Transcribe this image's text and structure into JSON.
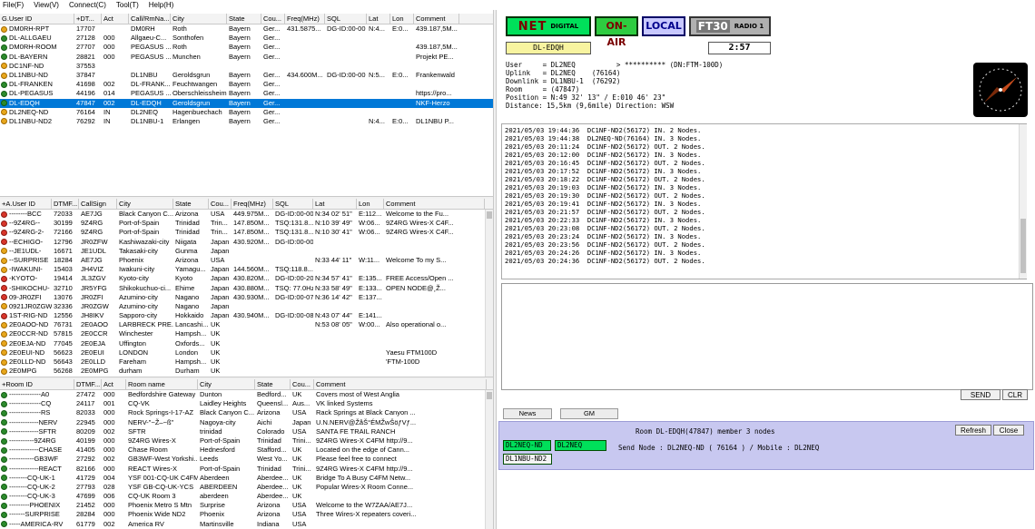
{
  "menu": [
    "File(F)",
    "View(V)",
    "Connect(C)",
    "Tool(T)",
    "Help(H)"
  ],
  "colors": {
    "selected_row": "#0078d7",
    "net_green": "#00e05a",
    "onair_green": "#2ecc40",
    "local_blue": "#c8c8ff",
    "radio_gray": "#b0b0b0",
    "room_panel": "#c8c8f0"
  },
  "top_grid": {
    "headers": [
      "G.User ID",
      "+DT...",
      "Act",
      "Call/RmNa...",
      "City",
      "State",
      "Cou...",
      "Freq(MHz)",
      "SQL",
      "Lat",
      "Lon",
      "Comment"
    ],
    "rows": [
      {
        "icon": "node",
        "c": [
          "DM0RH-RPT",
          "17707",
          "",
          "DM0RH",
          "Roth",
          "Bayern",
          "Ger...",
          "431.5875...",
          "DG-ID:00-00",
          "N:4...",
          "E:0...",
          "439.187,5M..."
        ]
      },
      {
        "icon": "room",
        "c": [
          "DL-ALLGAEU",
          "27128",
          "000",
          "Allgaeu-C...",
          "Sonthofen",
          "Bayern",
          "Ger...",
          "",
          "",
          "",
          "",
          ""
        ]
      },
      {
        "icon": "room",
        "c": [
          "DM0RH-ROOM",
          "27707",
          "000",
          "PEGASUS ...",
          "Roth",
          "Bayern",
          "Ger...",
          "",
          "",
          "",
          "",
          "439.187,5M..."
        ]
      },
      {
        "icon": "room",
        "c": [
          "DL-BAYERN",
          "28821",
          "000",
          "PEGASUS ...",
          "Munchen",
          "Bayern",
          "Ger...",
          "",
          "",
          "",
          "",
          "Projekt PE..."
        ]
      },
      {
        "icon": "node",
        "c": [
          "DC1NF-ND",
          "37553",
          "",
          "",
          "",
          "",
          "",
          "",
          "",
          "",
          "",
          ""
        ]
      },
      {
        "icon": "node",
        "c": [
          "DL1NBU-ND",
          "37847",
          "",
          "DL1NBU",
          "Geroldsgrun",
          "Bayern",
          "Ger...",
          "434.600M...",
          "DG-ID:00-00",
          "N:5...",
          "E:0...",
          "Frankenwald"
        ]
      },
      {
        "icon": "room",
        "c": [
          "DL-FRANKEN",
          "41698",
          "002",
          "DL-FRANK...",
          "Feuchtwangen",
          "Bayern",
          "Ger...",
          "",
          "",
          "",
          "",
          ""
        ]
      },
      {
        "icon": "room",
        "c": [
          "DL-PEGASUS",
          "44196",
          "014",
          "PEGASUS ...",
          "Oberschleissheim",
          "Bayern",
          "Ger...",
          "",
          "",
          "",
          "",
          "https://pro..."
        ]
      },
      {
        "icon": "room",
        "sel": true,
        "c": [
          "DL-EDQH",
          "47847",
          "002",
          "DL-EDQH",
          "Geroldsgrun",
          "Bayern",
          "Ger...",
          "",
          "",
          "",
          "",
          "NKF-Herzo"
        ]
      },
      {
        "icon": "node",
        "c": [
          "DL2NEQ-ND",
          "76164",
          "IN",
          "DL2NEQ",
          "Hagenbuechach",
          "Bayern",
          "Ger...",
          "",
          "",
          "",
          "",
          ""
        ]
      },
      {
        "icon": "node",
        "c": [
          "DL1NBU-ND2",
          "76292",
          "IN",
          "DL1NBU-1",
          "Erlangen",
          "Bayern",
          "Ger...",
          "",
          "",
          "N:4...",
          "E:0...",
          "DL1NBU P..."
        ]
      }
    ]
  },
  "mid_grid": {
    "headers": [
      "+A.User ID",
      "DTMF...",
      "CallSign",
      "City",
      "State",
      "Cou...",
      "Freq(MHz)",
      "SQL",
      "Lat",
      "Lon",
      "Comment"
    ],
    "rows": [
      {
        "icon": "usr",
        "c": [
          "--------BCC",
          "72033",
          "AE7JG",
          "Black Canyon C...",
          "Arizona",
          "USA",
          "449.975M...",
          "DG-ID:00-00",
          "N:34 02' 51\"",
          "E:112...",
          "Welcome to the Fu..."
        ]
      },
      {
        "icon": "usr",
        "c": [
          "--9Z4RG--",
          "30199",
          "9Z4RG",
          "Port-of-Spain",
          "Trinidad",
          "Trin...",
          "147.850M...",
          "TSQ:131.8...",
          "N:10 39' 49\"",
          "W:06...",
          "9Z4RG Wires-X C4F..."
        ]
      },
      {
        "icon": "usr",
        "c": [
          "--9Z4RG-2-",
          "72166",
          "9Z4RG",
          "Port-of-Spain",
          "Trinidad",
          "Trin...",
          "147.850M...",
          "TSQ:131.8...",
          "N:10 30' 41\"",
          "W:06...",
          "9Z4RG Wires-X C4F..."
        ]
      },
      {
        "icon": "usr",
        "c": [
          "--ECHIGO-",
          "12796",
          "JR0ZFW",
          "Kashiwazaki-city",
          "Niigata",
          "Japan",
          "430.920M...",
          "DG-ID:00-00",
          "",
          "",
          ""
        ]
      },
      {
        "icon": "node",
        "c": [
          "--JE1UDL-",
          "16671",
          "JE1UDL",
          "Takasaki-city",
          "Gunma",
          "Japan",
          "",
          "",
          "",
          "",
          ""
        ]
      },
      {
        "icon": "node",
        "c": [
          "--SURPRISE",
          "18284",
          "AE7JG",
          "Phoenix",
          "Arizona",
          "USA",
          "",
          "",
          "N:33 44' 11\"",
          "W:11...",
          "Welcome To my S..."
        ]
      },
      {
        "icon": "node",
        "c": [
          "-IWAKUNI-",
          "15403",
          "JH4VIZ",
          "Iwakuni-city",
          "Yamagu...",
          "Japan",
          "144.560M...",
          "TSQ:118.8...",
          "",
          "",
          ""
        ]
      },
      {
        "icon": "usr",
        "c": [
          "-KYOTO-",
          "19414",
          "JL3ZGV",
          "Kyoto-city",
          "Kyoto",
          "Japan",
          "430.820M...",
          "DG-ID:00-20",
          "N:34 57' 41\"",
          "E:135...",
          "FREE Access/Open ..."
        ]
      },
      {
        "icon": "usr",
        "c": [
          "-SHIKOCHU-",
          "32710",
          "JR5YFG",
          "Shikokuchuo-ci...",
          "Ehime",
          "Japan",
          "430.880M...",
          "TSQ: 77.0Hz",
          "N:33 58' 49\"",
          "E:133...",
          "OPEN NODE@¸Ž..."
        ]
      },
      {
        "icon": "usr",
        "c": [
          "09-JR0ZFI",
          "13076",
          "JR0ZFI",
          "Azumino-city",
          "Nagano",
          "Japan",
          "430.930M...",
          "DG-ID:00-07",
          "N:36 14' 42\"",
          "E:137...",
          ""
        ]
      },
      {
        "icon": "node",
        "c": [
          "0921JR0ZGW",
          "32336",
          "JR0ZGW",
          "Azumino-city",
          "Nagano",
          "Japan",
          "",
          "",
          "",
          "",
          ""
        ]
      },
      {
        "icon": "usr",
        "c": [
          "1ST-RIG-ND",
          "12556",
          "JH8IKV",
          "Sapporo-city",
          "Hokkaido",
          "Japan",
          "430.940M...",
          "DG-ID:00-08",
          "N:43 07' 44\"",
          "E:141...",
          ""
        ]
      },
      {
        "icon": "node",
        "c": [
          "2E0AOO-ND",
          "76731",
          "2E0AOO",
          "LARBRECK PRE...",
          "Lancashi...",
          "UK",
          "",
          "",
          "N:53 08' 05\"",
          "W:00...",
          "Also operational o..."
        ]
      },
      {
        "icon": "node",
        "c": [
          "2E0CCR-ND",
          "57815",
          "2E0CCR",
          "Winchester",
          "Hampsh...",
          "UK",
          "",
          "",
          "",
          "",
          ""
        ]
      },
      {
        "icon": "node",
        "c": [
          "2E0EJA-ND",
          "77045",
          "2E0EJA",
          "Uffington",
          "Oxfords...",
          "UK",
          "",
          "",
          "",
          "",
          ""
        ]
      },
      {
        "icon": "node",
        "c": [
          "2E0EUI-ND",
          "56623",
          "2E0EUI",
          "LONDON",
          "London",
          "UK",
          "",
          "",
          "",
          "",
          "Yaesu FTM100D"
        ]
      },
      {
        "icon": "node",
        "c": [
          "2E0LLD-ND",
          "56643",
          "2E0LLD",
          "Fareham",
          "Hampsh...",
          "UK",
          "",
          "",
          "",
          "",
          "'FTM-100D"
        ]
      },
      {
        "icon": "node",
        "c": [
          "2E0MPG",
          "56268",
          "2E0MPG",
          "durham",
          "Durham",
          "UK",
          "",
          "",
          "",
          "",
          ""
        ]
      }
    ]
  },
  "bot_grid": {
    "headers": [
      "+Room ID",
      "DTMF...",
      "Act",
      "Room name",
      "City",
      "State",
      "Cou...",
      "Comment"
    ],
    "rows": [
      {
        "icon": "room",
        "c": [
          "--------------A0",
          "27472",
          "000",
          "Bedfordshire Gateway",
          "Dunton",
          "Bedford...",
          "UK",
          "Covers most of West Anglia"
        ]
      },
      {
        "icon": "room",
        "c": [
          "--------------CQ",
          "24117",
          "001",
          "CQ-VK",
          "Laidley Heights",
          "Queensl...",
          "Aus...",
          "VK linked Systems"
        ]
      },
      {
        "icon": "room",
        "c": [
          "--------------RS",
          "82033",
          "000",
          "Rock Springs-I-17-AZ",
          "Black Canyon C...",
          "Arizona",
          "USA",
          "Rack Springs at Black Canyon ..."
        ]
      },
      {
        "icon": "room",
        "c": [
          "-------------NERV",
          "22945",
          "000",
          "NERV-\"~Ž–~ß\"",
          "Nagoya-city",
          "Aichi",
          "Japan",
          "U.N.NERV@ŽåŠ°ÉMŽwŠöƒVƒ..."
        ]
      },
      {
        "icon": "room",
        "c": [
          "-------------SFTR",
          "80209",
          "002",
          "SFTR",
          "trinidad",
          "Colorado",
          "USA",
          "SANTA FE TRAIL RANCH"
        ]
      },
      {
        "icon": "room",
        "c": [
          "-----------9Z4RG",
          "40199",
          "000",
          "9Z4RG Wires-X",
          "Port-of-Spain",
          "Trinidad",
          "Trini...",
          "9Z4RG Wires-X C4FM http://9..."
        ]
      },
      {
        "icon": "room",
        "c": [
          "-------------CHASE",
          "41405",
          "000",
          "Chase Room",
          "Hednesford",
          "Stafford...",
          "UK",
          "Located on the edge of Cann..."
        ]
      },
      {
        "icon": "room",
        "c": [
          "-----------GB3WF",
          "27292",
          "002",
          "GB3WF-West Yorkshi...",
          "Leeds",
          "West Yo...",
          "UK",
          "Please feel free to connect"
        ]
      },
      {
        "icon": "room",
        "c": [
          "-------------REACT",
          "82166",
          "000",
          "REACT Wires-X",
          "Port-of-Spain",
          "Trinidad",
          "Trini...",
          "9Z4RG Wires-X C4FM http://9..."
        ]
      },
      {
        "icon": "room",
        "c": [
          "--------CQ-UK-1",
          "41729",
          "004",
          "YSF 001-CQ-UK C4FM",
          "Aberdeen",
          "Aberdee...",
          "UK",
          "Bridge To A Busy C4FM Netw..."
        ]
      },
      {
        "icon": "room",
        "c": [
          "--------CQ-UK-2",
          "27793",
          "028",
          "YSF GB-CQ-UK-YCS",
          "ABERDEEN",
          "Aberdee...",
          "UK",
          "Popular Wires-X Room Conne..."
        ]
      },
      {
        "icon": "room",
        "c": [
          "--------CQ-UK-3",
          "47699",
          "006",
          "CQ-UK Room 3",
          "aberdeen",
          "Aberdee...",
          "UK",
          ""
        ]
      },
      {
        "icon": "room",
        "c": [
          "---------PHOENIX",
          "21452",
          "000",
          "Phoenix Metro S Mtn",
          "Surprise",
          "Arizona",
          "USA",
          "Welcome to the W7ZAA/AE7J..."
        ]
      },
      {
        "icon": "room",
        "c": [
          "-------SURPRISE",
          "28284",
          "000",
          "Phoenix Wide ND2",
          "Phoenix",
          "Arizona",
          "USA",
          "Three Wires-X repeaters coveri..."
        ]
      },
      {
        "icon": "room",
        "c": [
          "-----AMERICA-RV",
          "61779",
          "002",
          "America RV",
          "Martinsville",
          "Indiana",
          "USA",
          ""
        ]
      }
    ]
  },
  "status": {
    "net": "NET",
    "digital": "DIGITAL",
    "onair": "ON-AIR",
    "local": "LOCAL",
    "ft": "FT30",
    "radio": "RADIO 1",
    "room_name": "DL-EDQH",
    "timer": "2:57"
  },
  "info_lines": [
    "User     = DL2NEQ          > ********** (DN:FTM-100D)",
    "Uplink   = DL2NEQ    (76164)",
    "Downlink = DL1NBU-1  (76292)",
    "Room     = (47847)",
    "Position = N:49 32' 13\" / E:010 46' 23\"",
    "Distance: 15,5km (9,6mile) Direction: WSW"
  ],
  "log_lines": [
    "2021/05/03 19:44:36  DC1NF-ND2(56172) IN. 2 Nodes.",
    "2021/05/03 19:44:38  DL2NEQ-ND(76164) IN. 3 Nodes.",
    "2021/05/03 20:11:24  DC1NF-ND2(56172) OUT. 2 Nodes.",
    "2021/05/03 20:12:00  DC1NF-ND2(56172) IN. 3 Nodes.",
    "2021/05/03 20:16:45  DC1NF-ND2(56172) OUT. 2 Nodes.",
    "2021/05/03 20:17:52  DC1NF-ND2(56172) IN. 3 Nodes.",
    "2021/05/03 20:18:22  DC1NF-ND2(56172) OUT. 2 Nodes.",
    "2021/05/03 20:19:03  DC1NF-ND2(56172) IN. 3 Nodes.",
    "2021/05/03 20:19:30  DC1NF-ND2(56172) OUT. 2 Nodes.",
    "2021/05/03 20:19:41  DC1NF-ND2(56172) IN. 3 Nodes.",
    "2021/05/03 20:21:57  DC1NF-ND2(56172) OUT. 2 Nodes.",
    "2021/05/03 20:22:33  DC1NF-ND2(56172) IN. 3 Nodes.",
    "2021/05/03 20:23:08  DC1NF-ND2(56172) OUT. 2 Nodes.",
    "2021/05/03 20:23:24  DC1NF-ND2(56172) IN. 3 Nodes.",
    "2021/05/03 20:23:56  DC1NF-ND2(56172) OUT. 2 Nodes.",
    "2021/05/03 20:24:26  DC1NF-ND2(56172) IN. 3 Nodes.",
    "2021/05/03 20:24:36  DC1NF-ND2(56172) OUT. 2 Nodes."
  ],
  "buttons": {
    "send": "SEND",
    "clr": "CLR",
    "news": "News",
    "gm": "GM",
    "refresh": "Refresh",
    "close": "Close"
  },
  "room_panel": {
    "title": "Room DL-EDQH(47847) member 3 nodes",
    "send_node": "Send Node : DL2NEQ-ND ( 76164 ) / Mobile : DL2NEQ",
    "nodes": [
      "DL2NEQ-ND",
      "DL2NEQ",
      "DL1NBU-ND2"
    ]
  }
}
